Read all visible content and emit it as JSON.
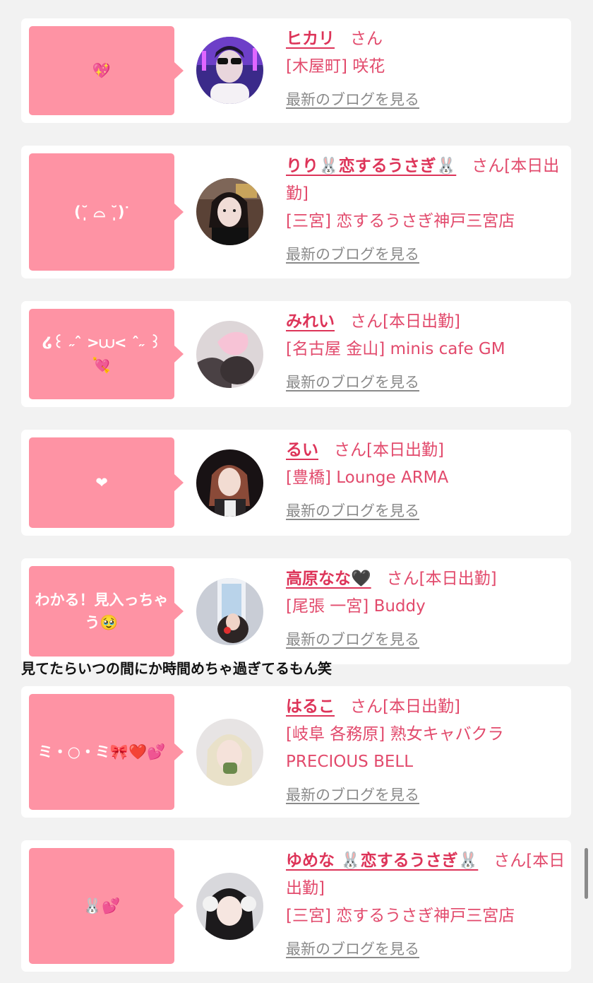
{
  "cards": [
    {
      "bubble": "💖",
      "name": "ヒカリ",
      "san": "さん",
      "status": "",
      "shop": "[木屋町] 咲花",
      "blog": "最新のブログを見る"
    },
    {
      "bubble": "(˘̩̩̩ ⌓ ˘̩̩̩)ᐝ",
      "name": "りり🐰恋するうさぎ🐰",
      "san": "さん",
      "status": "[本日出勤]",
      "shop": "[三宮] 恋するうさぎ神戸三宮店",
      "blog": "最新のブログを見る"
    },
    {
      "bubble": "໒꒰ ˶ˆ >⩊< ˆ˶ ꒱ 💘",
      "name": "みれい",
      "san": "さん",
      "status": "[本日出勤]",
      "shop": "[名古屋 金山] minis cafe GM",
      "blog": "最新のブログを見る"
    },
    {
      "bubble": "❤",
      "name": "るい",
      "san": "さん",
      "status": "[本日出勤]",
      "shop": "[豊橋] Lounge ARMA",
      "blog": "最新のブログを見る"
    },
    {
      "bubble": "わかる！見入っちゃう🥹",
      "name": "高原なな🖤",
      "san": "さん",
      "status": "[本日出勤]",
      "shop": "[尾張 一宮] Buddy",
      "blog": "最新のブログを見る"
    },
    {
      "bubble": "ミ・○・ミ🎀❤️💕",
      "name": "はるこ",
      "san": "さん",
      "status": "[本日出勤]",
      "shop": "[岐阜 各務原]  熟女キャバクラ PRECIOUS BELL",
      "blog": "最新のブログを見る"
    },
    {
      "bubble": "🐰💕",
      "name": "ゆめな 🐰恋するうさぎ🐰",
      "san": "さん",
      "status": "[本日出勤]",
      "shop": "[三宮] 恋するうさぎ神戸三宮店",
      "blog": "最新のブログを見る"
    }
  ],
  "caption": "見てたらいつの間にか時間めちゃ過ぎてるもん笑",
  "colors": {
    "bubble": "#fe93a4",
    "name": "#dd3459",
    "shop": "#e24a6c",
    "link": "#8a8a8a",
    "background": "#f2f2f2"
  }
}
